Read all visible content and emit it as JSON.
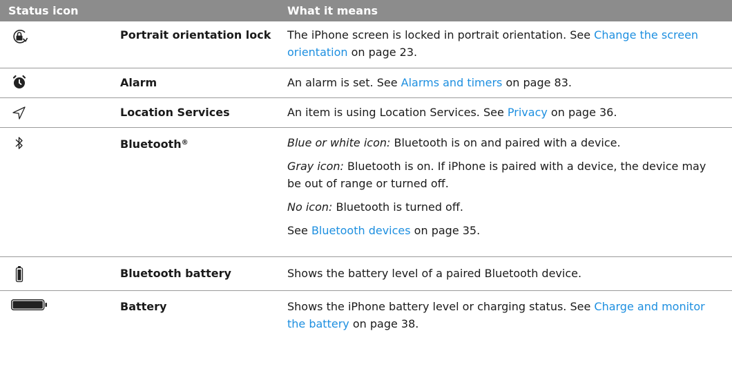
{
  "header": {
    "col_icon": "Status icon",
    "col_meaning": "What it means"
  },
  "rows": [
    {
      "icon": "portrait-orientation-lock-icon",
      "name": "Portrait orientation lock",
      "desc": {
        "text": "The iPhone screen is locked in portrait orientation. See ",
        "link": "Change the screen orientation",
        "tail": " on page 23."
      }
    },
    {
      "icon": "alarm-icon",
      "name": "Alarm",
      "desc": {
        "text": "An alarm is set. See ",
        "link": "Alarms and timers",
        "tail": " on page 83."
      }
    },
    {
      "icon": "location-services-icon",
      "name": "Location Services",
      "desc": {
        "text": "An item is using Location Services. See ",
        "link": "Privacy",
        "tail": " on page 36."
      }
    },
    {
      "icon": "bluetooth-icon",
      "name": "Bluetooth",
      "name_mark": "®",
      "p1": {
        "label": "Blue or white icon:",
        "text": "  Bluetooth is on and paired with a device."
      },
      "p2": {
        "label": "Gray icon:",
        "text": "  Bluetooth is on. If iPhone is paired with a device, the device may be out of range or turned off."
      },
      "p3": {
        "label": "No icon:",
        "text": "  Bluetooth is turned off."
      },
      "p4": {
        "text": "See ",
        "link": "Bluetooth devices",
        "tail": " on page 35."
      }
    },
    {
      "icon": "bluetooth-battery-icon",
      "name": "Bluetooth battery",
      "desc": {
        "text": "Shows the battery level of a paired Bluetooth device."
      }
    },
    {
      "icon": "battery-icon",
      "name": "Battery",
      "desc": {
        "text": "Shows the iPhone battery level or charging status. See ",
        "link": "Charge and monitor the battery",
        "tail": " on page 38."
      }
    }
  ],
  "colors": {
    "header_bg": "#8c8c8c",
    "link": "#1d8fe0",
    "rule": "#9a9a9a"
  }
}
